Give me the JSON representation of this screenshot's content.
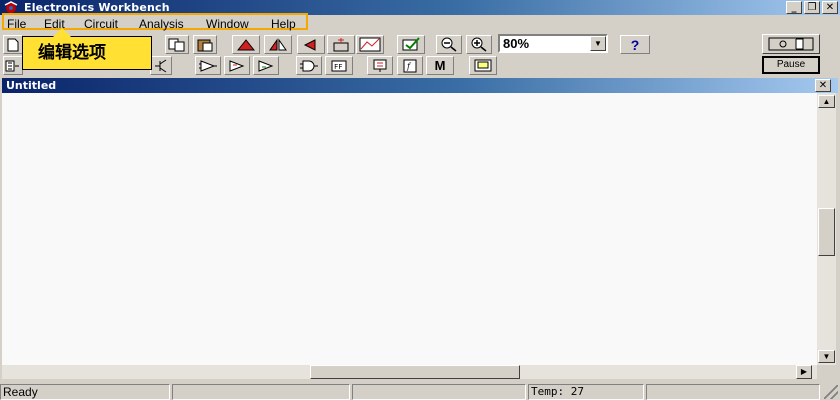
{
  "app": {
    "title": "Electronics Workbench"
  },
  "window_controls": {
    "minimize": "_",
    "restore": "❐",
    "close": "✕"
  },
  "menu": [
    {
      "label": "File"
    },
    {
      "label": "Edit"
    },
    {
      "label": "Circuit"
    },
    {
      "label": "Analysis"
    },
    {
      "label": "Window"
    },
    {
      "label": "Help"
    }
  ],
  "tooltip": {
    "text": "编辑选项"
  },
  "toolbar": {
    "zoom_value": "80%",
    "help_label": "?",
    "meter_label": "M",
    "pause_label": "Pause",
    "icons": [
      "new-icon",
      "copy-icon",
      "paste-icon",
      "rotate-icon",
      "flip-horizontal-icon",
      "flip-vertical-icon",
      "subcircuit-icon",
      "graph-icon",
      "component-properties-icon",
      "zoom-out-icon",
      "zoom-in-icon",
      "power-switch-icon"
    ]
  },
  "document": {
    "title": "Untitled"
  },
  "status": {
    "ready": "Ready",
    "temp": "Temp:  27"
  },
  "colors": {
    "titlebar_start": "#0a246a",
    "titlebar_end": "#a6caf0",
    "tooltip": "#ffe033",
    "highlight": "#f5a800",
    "face": "#d4d0c8"
  }
}
